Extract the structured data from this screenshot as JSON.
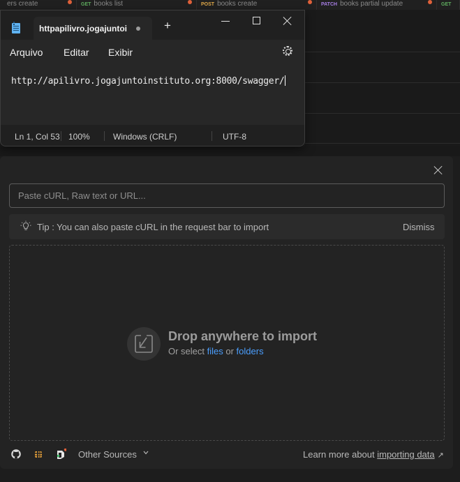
{
  "background": {
    "tabs": [
      {
        "method": "",
        "label": "ers create",
        "method_color": "#8a8a8a"
      },
      {
        "method": "GET",
        "label": "books list",
        "method_color": "#5fae5f"
      },
      {
        "method": "POST",
        "label": "books create",
        "method_color": "#e0a94a"
      },
      {
        "method": "PATCH",
        "label": "books partial update",
        "method_color": "#a67de3"
      },
      {
        "method": "GET",
        "label": "",
        "method_color": "#5fae5f"
      }
    ]
  },
  "notepad": {
    "tab_title": "httpapilivro.jogajuntoi",
    "new_tab": "+",
    "menu": {
      "file": "Arquivo",
      "edit": "Editar",
      "view": "Exibir"
    },
    "content": "http://apilivro.jogajuntoinstituto.org:8000/swagger/",
    "status": {
      "position": "Ln 1, Col 53",
      "zoom": "100%",
      "line_ending": "Windows (CRLF)",
      "encoding": "UTF-8"
    }
  },
  "import": {
    "input_placeholder": "Paste cURL, Raw text or URL...",
    "tip": "Tip : You can also paste cURL in the request bar to import",
    "dismiss": "Dismiss",
    "drop_title": "Drop anywhere to import",
    "drop_sub_prefix": "Or select ",
    "files_link": "files",
    "or_text": " or ",
    "folders_link": "folders",
    "other_sources": "Other Sources",
    "learn_prefix": "Learn more about ",
    "learn_link": "importing data",
    "learn_arrow": "↗"
  }
}
